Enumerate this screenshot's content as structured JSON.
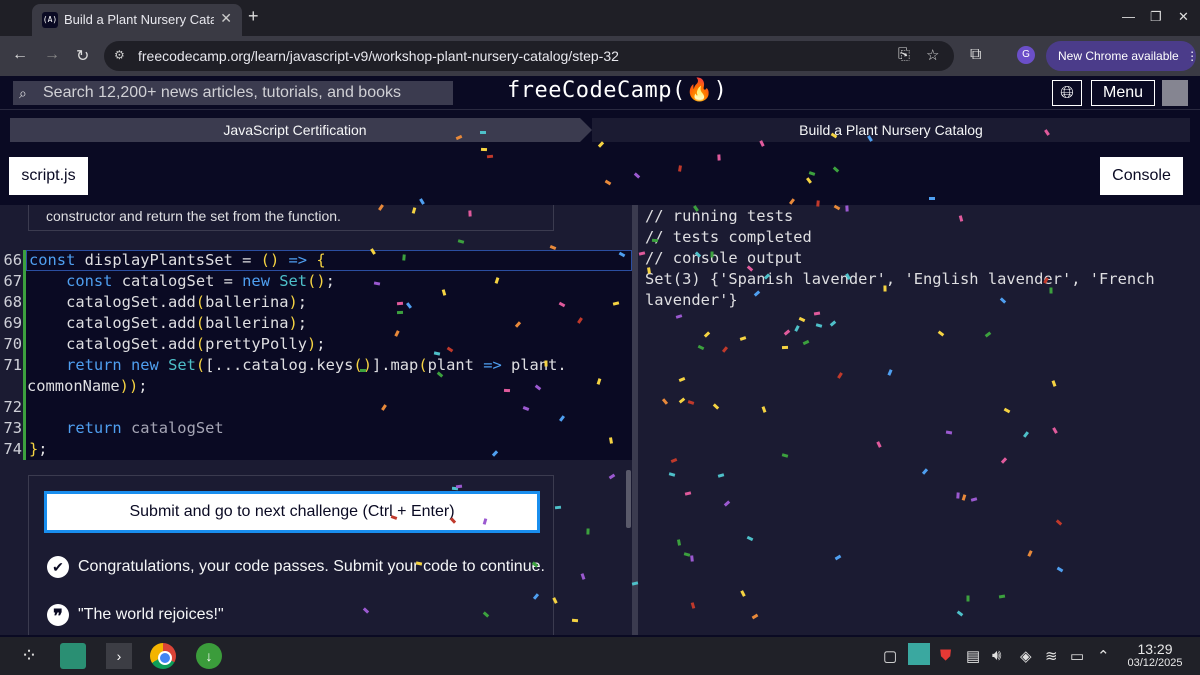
{
  "browser": {
    "tab_title": "Build a Plant Nursery Catalog",
    "tab_favicon": "(A)",
    "new_tab": "+",
    "url": "freecodecamp.org/learn/javascript-v9/workshop-plant-nursery-catalog/step-32",
    "profile_initial": "G",
    "update_label": "New Chrome available"
  },
  "fcc_nav": {
    "search_placeholder": "Search 12,200+ news articles, tutorials, and books",
    "logo_text": "freeCodeCamp(🔥)",
    "menu_label": "Menu"
  },
  "breadcrumbs": [
    "JavaScript Certification",
    "Build a Plant Nursery Catalog"
  ],
  "tabs": {
    "editor_tab": "script.js",
    "console_tab": "Console"
  },
  "editor": {
    "description_tail": "constructor and return the set from the function.",
    "lines": [
      {
        "num": "66",
        "text": "const displayPlantsSet = () => {"
      },
      {
        "num": "67",
        "text": "    const catalogSet = new Set();"
      },
      {
        "num": "68",
        "text": "    catalogSet.add(ballerina);"
      },
      {
        "num": "69",
        "text": "    catalogSet.add(ballerina);"
      },
      {
        "num": "70",
        "text": "    catalogSet.add(prettyPolly);"
      },
      {
        "num": "71",
        "text": "    return new Set([...catalog.keys()].map(plant => plant."
      },
      {
        "num": "",
        "text": "commonName));"
      },
      {
        "num": "72",
        "text": ""
      },
      {
        "num": "73",
        "text": "    return catalogSet"
      },
      {
        "num": "74",
        "text": "};"
      }
    ]
  },
  "challenge": {
    "submit_label": "Submit and go to next challenge (Ctrl + Enter)",
    "success_message": "Congratulations, your code passes. Submit your code to continue.",
    "quote": "\"The world rejoices!\""
  },
  "console": {
    "lines": [
      "// running tests",
      "// tests completed",
      "// console output",
      "Set(3) {'Spanish lavender', 'English lavender', 'French",
      "lavender'}"
    ]
  },
  "taskbar": {
    "time": "13:29",
    "date": "03/12/2025"
  },
  "colors": {
    "background": "#0a0a23",
    "panel": "#1b1b32",
    "submit_border": "#198eee",
    "keyword": "#4f9ff0",
    "bracket": "#f5d342"
  }
}
